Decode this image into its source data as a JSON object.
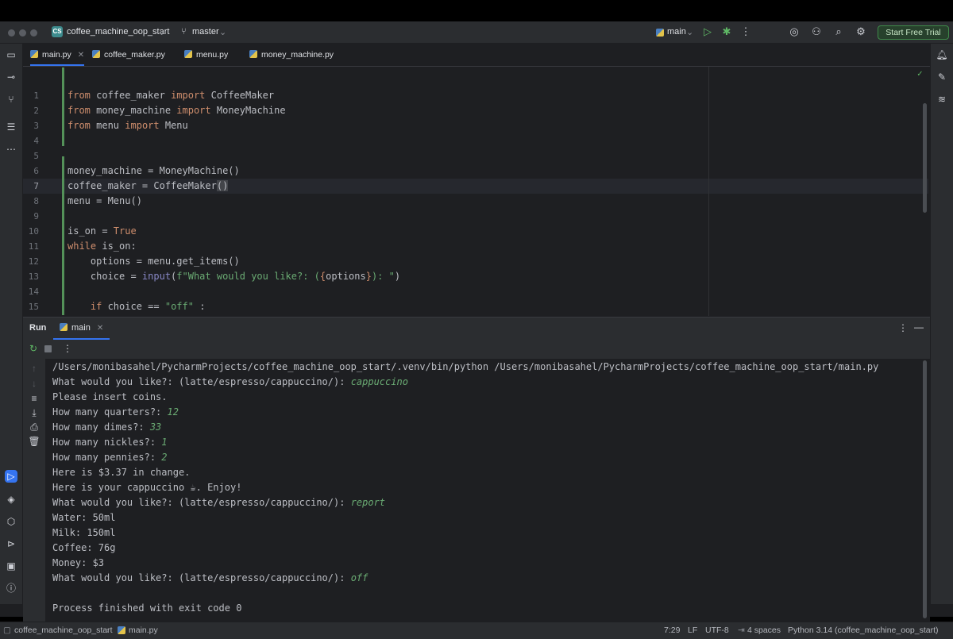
{
  "titlebar": {
    "project_badge": "CS",
    "project_name": "coffee_machine_oop_start",
    "branch": "master",
    "run_config": "main",
    "start_trial": "Start Free Trial"
  },
  "tabs": [
    {
      "label": "main.py"
    },
    {
      "label": "coffee_maker.py"
    },
    {
      "label": "menu.py"
    },
    {
      "label": "money_machine.py"
    }
  ],
  "editor": {
    "line_numbers": [
      "1",
      "2",
      "3",
      "4",
      "5",
      "6",
      "7",
      "8",
      "9",
      "10",
      "11",
      "12",
      "13",
      "14",
      "15"
    ],
    "current_line": "7"
  },
  "run_panel": {
    "title": "Run",
    "tab_label": "main"
  },
  "console": {
    "command": "/Users/monibasahel/PycharmProjects/coffee_machine_oop_start/.venv/bin/python /Users/monibasahel/PycharmProjects/coffee_machine_oop_start/main.py",
    "prompt": "What would you like?: (latte/espresso/cappuccino/): ",
    "input_1": "cappuccino",
    "insert_coins": "Please insert coins.",
    "quarters_q": "How many quarters?: ",
    "quarters_a": "12",
    "dimes_q": "How many dimes?: ",
    "dimes_a": "33",
    "nickles_q": "How many nickles?: ",
    "nickles_a": "1",
    "pennies_q": "How many pennies?: ",
    "pennies_a": "2",
    "change": "Here is $3.37 in change.",
    "enjoy": "Here is your cappuccino ☕. Enjoy!",
    "input_2": "report",
    "water": "Water: 50ml",
    "milk": "Milk: 150ml",
    "coffee": "Coffee: 76g",
    "money": "Money: $3",
    "input_3": "off",
    "finished": "Process finished with exit code 0"
  },
  "statusbar": {
    "project": "coffee_machine_oop_start",
    "file": "main.py",
    "position": "7:29",
    "line_sep": "LF",
    "encoding": "UTF-8",
    "indent": "4 spaces",
    "interpreter": "Python 3.14 (coffee_machine_oop_start)"
  },
  "colors": {
    "accent": "#3574f0",
    "keyword": "#cf8e6d",
    "string": "#6aab73",
    "function": "#56a8f5",
    "trial_border": "#3f8a4a"
  }
}
